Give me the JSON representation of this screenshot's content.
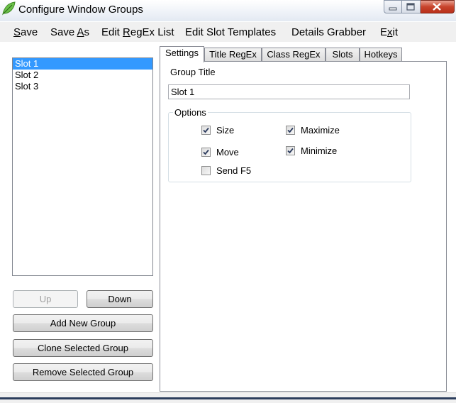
{
  "window": {
    "title": "Configure Window Groups"
  },
  "menu": [
    {
      "pre": "",
      "mnemonic": "S",
      "post": "ave"
    },
    {
      "pre": "Save ",
      "mnemonic": "A",
      "post": "s"
    },
    {
      "pre": "Edit ",
      "mnemonic": "R",
      "post": "egEx List"
    },
    {
      "pre": "Edit Slot Templates",
      "mnemonic": "",
      "post": ""
    },
    {
      "pre": "Details Grabber",
      "mnemonic": "",
      "post": ""
    },
    {
      "pre": "E",
      "mnemonic": "x",
      "post": "it"
    }
  ],
  "groups": [
    {
      "label": "Slot 1",
      "selected": true
    },
    {
      "label": "Slot 2",
      "selected": false
    },
    {
      "label": "Slot 3",
      "selected": false
    }
  ],
  "buttons": {
    "up": "Up",
    "down": "Down",
    "add": "Add New Group",
    "clone": "Clone Selected Group",
    "remove": "Remove Selected Group"
  },
  "tabs": [
    "Settings",
    "Title RegEx",
    "Class RegEx",
    "Slots",
    "Hotkeys"
  ],
  "settings": {
    "group_title_label": "Group Title",
    "group_title_value": "Slot 1",
    "options_label": "Options",
    "options": [
      {
        "label": "Size",
        "checked": true
      },
      {
        "label": "Maximize",
        "checked": true
      },
      {
        "label": "Move",
        "checked": true
      },
      {
        "label": "Minimize",
        "checked": true
      },
      {
        "label": "Send F5",
        "checked": false
      }
    ]
  }
}
